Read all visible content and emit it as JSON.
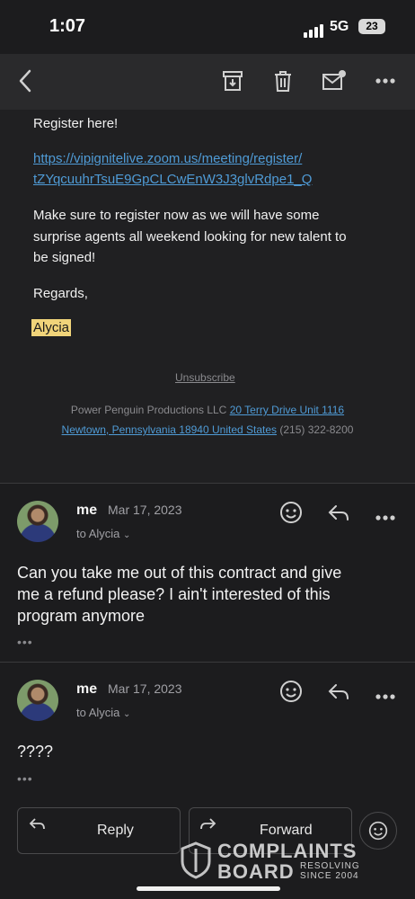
{
  "status_bar": {
    "time": "1:07",
    "network": "5G",
    "battery": "23"
  },
  "toolbar": {
    "icons": [
      "back-icon",
      "archive-icon",
      "trash-icon",
      "mark-unread-icon",
      "more-icon"
    ]
  },
  "email": {
    "register_line": "Register here!",
    "link_line1": "https://vipignitelive.zoom.us/meeting/register/",
    "link_line2": "tZYqcuuhrTsuE9GpCLCwEnW3J3glvRdpe1_Q",
    "para_line1": "Make sure to register now as we will have some",
    "para_line2": "surprise agents all weekend looking for new talent to",
    "para_line3": "be signed!",
    "regards": "Regards,",
    "signature": "Alycia",
    "unsubscribe": "Unsubscribe",
    "footer_company": "Power Penguin Productions LLC",
    "footer_address1": "20 Terry Drive Unit 1116",
    "footer_address2": "Newtown, Pennsylvania 18940 United States",
    "footer_phone": "(215) 322-8200"
  },
  "replies": [
    {
      "sender": "me",
      "date": "Mar 17, 2023",
      "to": "to Alycia",
      "line1": "Can you take me out of this contract and give",
      "line2": "me a refund please? I ain't interested of this",
      "line3": "program anymore",
      "more": "•••"
    },
    {
      "sender": "me",
      "date": "Mar 17, 2023",
      "to": "to Alycia",
      "line1": "????",
      "more": "•••"
    }
  ],
  "actions": {
    "reply": "Reply",
    "forward": "Forward"
  },
  "watermark": {
    "line1": "COMPLAINTS",
    "line2": "BOARD",
    "tag1": "RESOLVING",
    "tag2": "SINCE 2004"
  },
  "colors": {
    "link": "#4f9bd6",
    "highlight": "#f1d47a",
    "background": "#1c1c1e"
  }
}
